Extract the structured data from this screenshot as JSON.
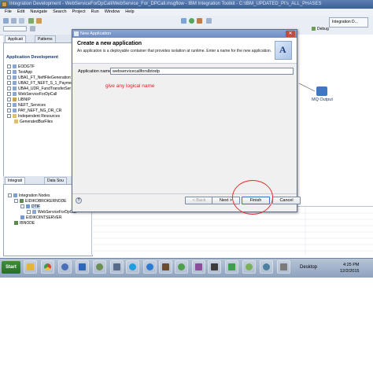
{
  "window": {
    "title": "Integration Development - WebServiceForDpCall/WebService_For_DPCall.msgflow - IBM Integration Toolkit - C:\\IBM_UPDATED_PI's_ALL_PHASES"
  },
  "menu": [
    "File",
    "Edit",
    "Navigate",
    "Search",
    "Project",
    "Run",
    "Window",
    "Help"
  ],
  "perspective": {
    "label": "Integration D...",
    "debug": "Debug"
  },
  "left_tabs": [
    "Applicati",
    "Patterns"
  ],
  "app_dev": {
    "header": "Application Development",
    "items": [
      "EODGTF",
      "TestApp",
      "UBA1_FT_NeftFileGeneration",
      "UBA2_FT_NEFT_S_1_Payment",
      "UBA4_UDR_FundTransferSer",
      "WebServiceForDpCall",
      "LIBNIP",
      "NEFT_Services",
      "PAY_NEFT_NG_DR_CR",
      "Independent Resources",
      "GeneratedBarFiles"
    ]
  },
  "bottom_tabs": [
    "Integrati",
    "Data Sou"
  ],
  "integration": {
    "items": [
      "Integration Nodes",
      "EIDIKOBROKERNODE",
      "DTIF",
      "WebServiceForDpCall",
      "EIDIKOINTSERVER",
      "IBNODE"
    ]
  },
  "canvas": {
    "mq_output": "MQ Output"
  },
  "dialog": {
    "title": "New Application",
    "heading": "Create a new application",
    "description": "An application is a deployable container that provides isolation at runtime. Enter a name for the new application.",
    "name_label": "Application name",
    "name_value": "webservicecallforslbtodp",
    "annotation": "give any logical name",
    "buttons": {
      "back": "< Back",
      "next": "Next >",
      "finish": "Finish",
      "cancel": "Cancel"
    },
    "close": "✕"
  },
  "taskbar": {
    "start": "Start",
    "desktop": "Desktop",
    "time": "4:25 PM",
    "date": "12/2/2015"
  },
  "colors": {
    "accent": "#3a6fc3",
    "annotation": "#dd2222"
  }
}
